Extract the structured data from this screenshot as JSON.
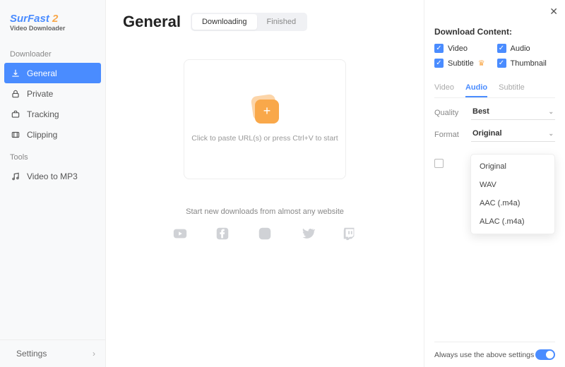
{
  "logo": {
    "text1": "SurFast",
    "text2": "2",
    "sub": "Video Downloader"
  },
  "sidebar": {
    "section1": "Downloader",
    "items": [
      {
        "label": "General"
      },
      {
        "label": "Private"
      },
      {
        "label": "Tracking"
      },
      {
        "label": "Clipping"
      }
    ],
    "section2": "Tools",
    "tools": [
      {
        "label": "Video to MP3"
      }
    ],
    "settings": "Settings"
  },
  "main": {
    "title": "General",
    "tabs": {
      "downloading": "Downloading",
      "finished": "Finished"
    },
    "drop_text": "Click to paste URL(s) or press Ctrl+V to start",
    "promo": "Start new downloads from almost any website"
  },
  "panel": {
    "title": "Download Content:",
    "checks": {
      "video": "Video",
      "audio": "Audio",
      "subtitle": "Subtitle",
      "thumbnail": "Thumbnail"
    },
    "subtabs": {
      "video": "Video",
      "audio": "Audio",
      "subtitle": "Subtitle"
    },
    "quality": {
      "label": "Quality",
      "value": "Best"
    },
    "format": {
      "label": "Format",
      "value": "Original"
    },
    "options": [
      "Original",
      "WAV",
      "AAC (.m4a)",
      "ALAC (.m4a)"
    ],
    "footer": "Always use the above settings"
  }
}
